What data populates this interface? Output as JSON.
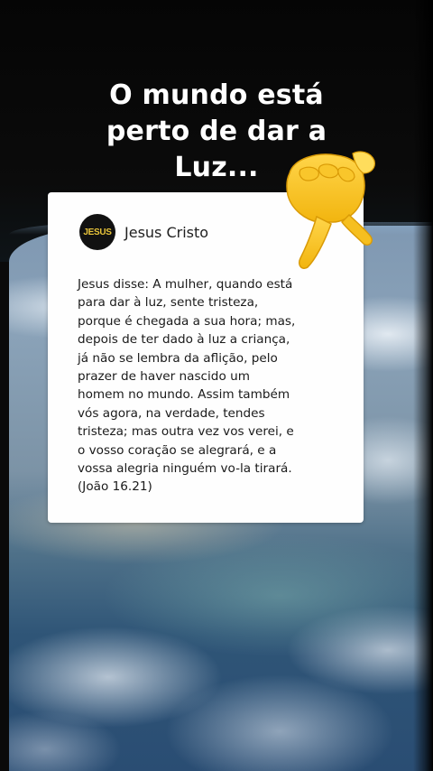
{
  "headline": {
    "lines": [
      "O mundo está",
      "perto de dar a",
      "Luz..."
    ]
  },
  "post": {
    "avatar_text": "JESUS",
    "author": "Jesus Cristo",
    "lines": [
      "Jesus disse: A mulher, quando está",
      "para dar à luz, sente tristeza,",
      "porque é chegada a sua hora; mas,",
      "depois de ter dado à luz a criança,",
      "já não se lembra da aflição, pelo",
      "prazer de haver nascido um",
      "homem no mundo. Assim também",
      "vós agora, na verdade, tendes",
      "tristeza; mas outra vez vos verei, e",
      "o vosso coração se alegrará, e a",
      "vossa alegria ninguém vo-la tirará.",
      "(João 16.21)"
    ]
  },
  "decorations": {
    "hand_icon": "backhand-index-pointing-down-icon",
    "hand_color": "#f7c21a",
    "avatar_text_color": "#e8c43a",
    "background": "earth-from-space"
  }
}
